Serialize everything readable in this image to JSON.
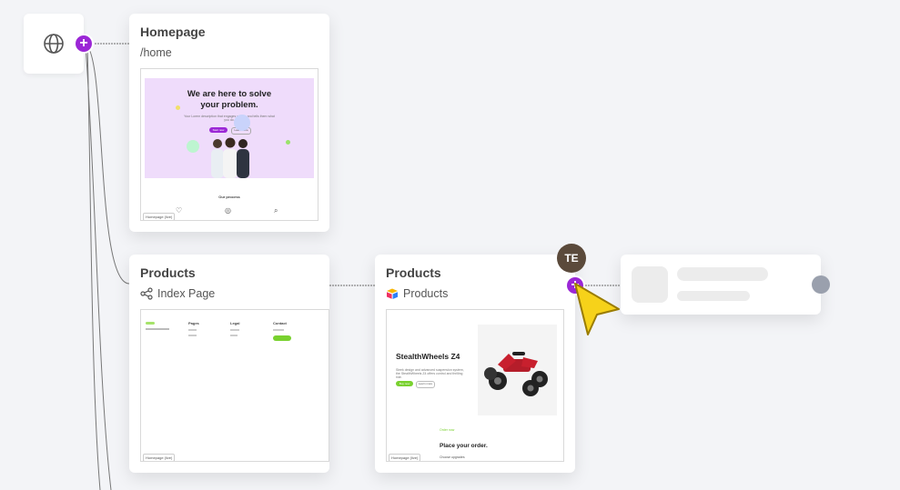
{
  "canvas": {
    "background": "#f3f4f7",
    "accent": "#9b27d6",
    "cursor_color": "#f6d21a"
  },
  "nodes": {
    "homepage": {
      "title": "Homepage",
      "path": "/home",
      "preview": {
        "headline": "We are here to solve your problem.",
        "body_text": "Your Lorem description that engages people and tells them what you do.",
        "primary_btn": "Start now",
        "secondary_btn": "Learn more",
        "section_title": "Our process",
        "badge": "Homepage (live)",
        "feature_icons": [
          "heart-icon",
          "check-circle-icon",
          "search-icon"
        ]
      }
    },
    "products_index": {
      "title": "Products",
      "subtitle": "Index Page",
      "icon": "share-nodes-icon",
      "preview": {
        "columns": [
          "Pages",
          "Legal",
          "Contact"
        ],
        "badge": "Homepage (live)"
      }
    },
    "products_cms": {
      "title": "Products",
      "subtitle": "Products",
      "icon": "airtable-icon",
      "preview": {
        "headline": "StealthWheels Z4",
        "body_text": "Sleek design and advanced suspension system, the StealthWheels Z4 offers control and thrilling ride.",
        "primary_btn": "Buy now",
        "secondary_btn": "Learn more",
        "order_eyebrow": "Order now",
        "order_title": "Place your order.",
        "order_sub": "Choose upgrades",
        "badge": "Homepage (live)"
      }
    }
  },
  "collaborator": {
    "initials": "TE",
    "color": "#5b4a3b"
  }
}
